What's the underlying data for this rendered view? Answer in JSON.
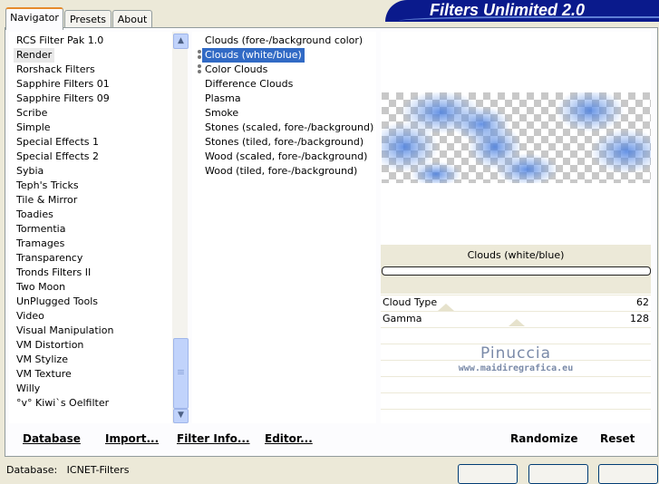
{
  "header": {
    "title": "Filters Unlimited 2.0"
  },
  "tabs": [
    {
      "label": "Navigator"
    },
    {
      "label": "Presets"
    },
    {
      "label": "About"
    }
  ],
  "categories": [
    "RCS Filter Pak 1.0",
    "Render",
    "Rorshack Filters",
    "Sapphire Filters 01",
    "Sapphire Filters 09",
    "Scribe",
    "Simple",
    "Special Effects 1",
    "Special Effects 2",
    "Sybia",
    "Teph's Tricks",
    "Tile & Mirror",
    "Toadies",
    "Tormentia",
    "Tramages",
    "Transparency",
    "Tronds Filters II",
    "Two Moon",
    "UnPlugged Tools",
    "Video",
    "Visual Manipulation",
    "VM Distortion",
    "VM Stylize",
    "VM Texture",
    "Willy",
    "°v° Kiwi`s Oelfilter"
  ],
  "filters": [
    "Clouds (fore-/background color)",
    "Clouds (white/blue)",
    "Color Clouds",
    "Difference Clouds",
    "Plasma",
    "Smoke",
    "Stones (scaled, fore-/background)",
    "Stones (tiled, fore-/background)",
    "Wood (scaled, fore-/background)",
    "Wood (tiled, fore-/background)"
  ],
  "preview": {
    "filter_name": "Clouds (white/blue)"
  },
  "params": [
    {
      "label": "Cloud Type",
      "value": "62"
    },
    {
      "label": "Gamma",
      "value": "128"
    }
  ],
  "watermark": {
    "line1": "Pinuccia",
    "line2": "www.maidiregrafica.eu"
  },
  "buttons": {
    "database": "Database",
    "import": "Import...",
    "filter_info": "Filter Info...",
    "editor": "Editor...",
    "randomize": "Randomize",
    "reset": "Reset"
  },
  "status": {
    "database": "Database:   ICNET-Filters"
  },
  "colors": {
    "title_bg": "#0a1a8c",
    "selection": "#316ac5"
  }
}
